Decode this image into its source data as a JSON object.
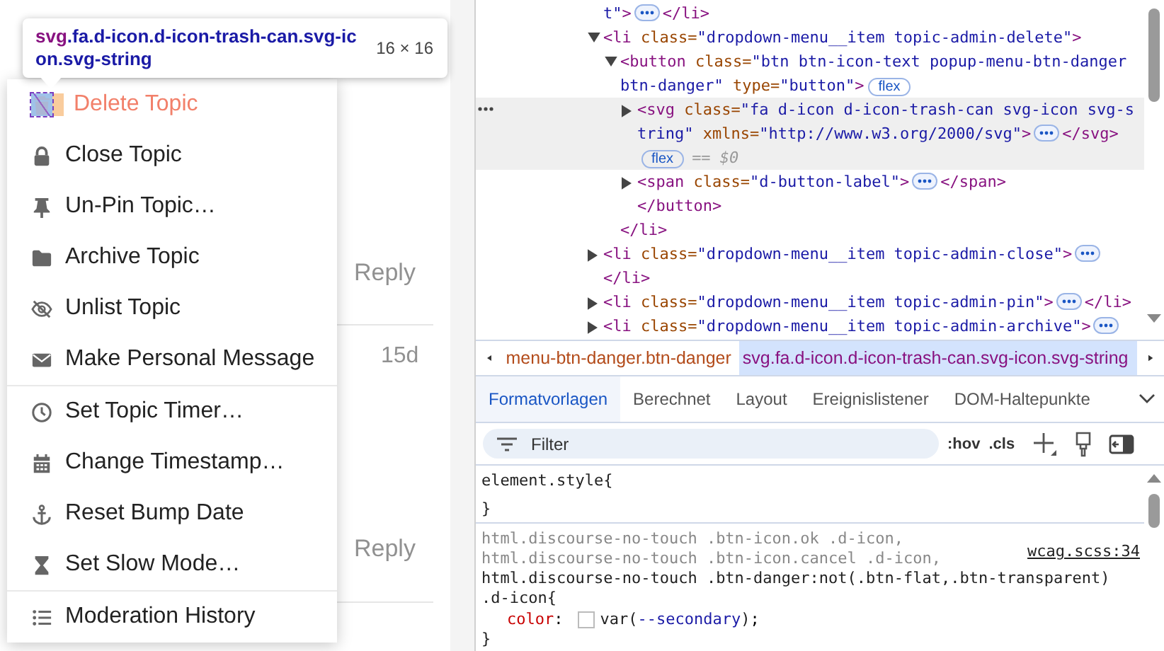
{
  "tooltip": {
    "tag": "svg",
    "classes": ".fa.d-icon.d-icon-trash-can.svg-icon.svg-string",
    "size": "16 × 16"
  },
  "page": {
    "replies": [
      {
        "label": "Reply"
      },
      {
        "label": "Reply"
      }
    ],
    "age": "15d"
  },
  "menu": {
    "sections": [
      [
        {
          "kind": "trash",
          "label": "Delete Topic",
          "danger": true,
          "highlighted": true
        },
        {
          "kind": "lock",
          "label": "Close Topic",
          "danger": false,
          "highlighted": false
        },
        {
          "kind": "pin",
          "label": "Un-Pin Topic…",
          "danger": false,
          "highlighted": false
        },
        {
          "kind": "folder",
          "label": "Archive Topic",
          "danger": false,
          "highlighted": false
        },
        {
          "kind": "unlist",
          "label": "Unlist Topic",
          "danger": false,
          "highlighted": false
        },
        {
          "kind": "message",
          "label": "Make Personal Message",
          "danger": false,
          "highlighted": false
        }
      ],
      [
        {
          "kind": "timer",
          "label": "Set Topic Timer…",
          "danger": false,
          "highlighted": false
        },
        {
          "kind": "timestamp",
          "label": "Change Timestamp…",
          "danger": false,
          "highlighted": false
        },
        {
          "kind": "bump",
          "label": "Reset Bump Date",
          "danger": false,
          "highlighted": false
        },
        {
          "kind": "slow",
          "label": "Set Slow Mode…",
          "danger": false,
          "highlighted": false
        }
      ],
      [
        {
          "kind": "history",
          "label": "Moderation History",
          "danger": false,
          "highlighted": false
        }
      ]
    ]
  },
  "elements": {
    "rows": [
      {
        "selected": false,
        "lines": [
          [
            {
              "kind": "value",
              "text": "t\""
            },
            {
              "kind": "tag",
              "text": ">"
            },
            {
              "kind": "more"
            },
            {
              "kind": "tag",
              "text": "</li>"
            }
          ]
        ]
      },
      {
        "expanded": true,
        "selected": false,
        "lines": [
          [
            {
              "kind": "tag",
              "text": "<li"
            },
            {
              "kind": "attr",
              "text": " class="
            },
            {
              "kind": "value",
              "text": "\"dropdown-menu__item topic-admin-delete\""
            },
            {
              "kind": "tag",
              "text": ">"
            }
          ]
        ],
        "children": [
          {
            "expanded": true,
            "selected": false,
            "lines": [
              [
                {
                  "kind": "tag",
                  "text": "<button"
                },
                {
                  "kind": "attr",
                  "text": " class="
                },
                {
                  "kind": "value",
                  "text": "\"btn btn-icon-text popup-menu-btn-danger"
                }
              ],
              [
                {
                  "kind": "value",
                  "text": "btn-danger\""
                },
                {
                  "kind": "attr",
                  "text": " type="
                },
                {
                  "kind": "value",
                  "text": "\"button\""
                },
                {
                  "kind": "tag",
                  "text": ">"
                },
                {
                  "kind": "badge",
                  "text": "flex"
                }
              ]
            ],
            "children": [
              {
                "expanded": false,
                "selected": true,
                "lines": [
                  [
                    {
                      "kind": "tag",
                      "text": "<svg"
                    },
                    {
                      "kind": "attr",
                      "text": " class="
                    },
                    {
                      "kind": "value",
                      "text": "\"fa d-icon d-icon-trash-can svg-icon svg-s"
                    }
                  ],
                  [
                    {
                      "kind": "value",
                      "text": "tring\""
                    },
                    {
                      "kind": "attr",
                      "text": " xmlns="
                    },
                    {
                      "kind": "value",
                      "text": "\"http://www.w3.org/2000/svg\""
                    },
                    {
                      "kind": "tag",
                      "text": ">"
                    },
                    {
                      "kind": "more"
                    },
                    {
                      "kind": "tag",
                      "text": "</svg>"
                    }
                  ],
                  [
                    {
                      "kind": "badge",
                      "text": "flex"
                    },
                    {
                      "kind": "ref",
                      "text": "== $0"
                    }
                  ]
                ]
              },
              {
                "expanded": false,
                "selected": false,
                "lines": [
                  [
                    {
                      "kind": "tag",
                      "text": "<span"
                    },
                    {
                      "kind": "attr",
                      "text": " class="
                    },
                    {
                      "kind": "value",
                      "text": "\"d-button-label\""
                    },
                    {
                      "kind": "tag",
                      "text": ">"
                    },
                    {
                      "kind": "more"
                    },
                    {
                      "kind": "tag",
                      "text": "</span>"
                    }
                  ]
                ]
              },
              {
                "selected": false,
                "lines": [
                  [
                    {
                      "kind": "tag",
                      "text": "</button>"
                    }
                  ]
                ]
              }
            ]
          },
          {
            "selected": false,
            "lines": [
              [
                {
                  "kind": "tag",
                  "text": "</li>"
                }
              ]
            ]
          }
        ]
      },
      {
        "expanded": false,
        "selected": false,
        "lines": [
          [
            {
              "kind": "tag",
              "text": "<li"
            },
            {
              "kind": "attr",
              "text": " class="
            },
            {
              "kind": "value",
              "text": "\"dropdown-menu__item topic-admin-close\""
            },
            {
              "kind": "tag",
              "text": ">"
            },
            {
              "kind": "more"
            }
          ]
        ]
      },
      {
        "selected": false,
        "lines": [
          [
            {
              "kind": "tag",
              "text": "</li>"
            }
          ]
        ]
      },
      {
        "expanded": false,
        "selected": false,
        "lines": [
          [
            {
              "kind": "tag",
              "text": "<li"
            },
            {
              "kind": "attr",
              "text": " class="
            },
            {
              "kind": "value",
              "text": "\"dropdown-menu__item topic-admin-pin\""
            },
            {
              "kind": "tag",
              "text": ">"
            },
            {
              "kind": "more"
            },
            {
              "kind": "tag",
              "text": "</li>"
            }
          ]
        ]
      },
      {
        "expanded": false,
        "selected": false,
        "lines": [
          [
            {
              "kind": "tag",
              "text": "<li"
            },
            {
              "kind": "attr",
              "text": " class="
            },
            {
              "kind": "value",
              "text": "\"dropdown-menu__item topic-admin-archive\""
            },
            {
              "kind": "tag",
              "text": ">"
            },
            {
              "kind": "more"
            }
          ]
        ]
      }
    ]
  },
  "breadcrumbs": [
    {
      "text": "menu-btn-danger.btn-danger",
      "selected": false
    },
    {
      "text": "svg.fa.d-icon.d-icon-trash-can.svg-icon.svg-string",
      "selected": true
    }
  ],
  "tabs": [
    {
      "label": "Formatvorlagen",
      "selected": true
    },
    {
      "label": "Berechnet",
      "selected": false
    },
    {
      "label": "Layout",
      "selected": false
    },
    {
      "label": "Ereignislistener",
      "selected": false
    },
    {
      "label": "DOM-Haltepunkte",
      "selected": false
    }
  ],
  "filter": {
    "placeholder": "Filter",
    "hov": ":hov",
    "cls": ".cls"
  },
  "rules": [
    {
      "selectors": [
        {
          "text": "element.style",
          "matched": true
        }
      ],
      "open": "{",
      "close": "}"
    },
    {
      "source": "wcag.scss:34",
      "selectors": [
        {
          "text": "html.discourse-no-touch .btn-icon.ok .d-icon,",
          "matched": false
        },
        {
          "text": "html.discourse-no-touch .btn-icon.cancel .d-icon,",
          "matched": false
        },
        {
          "text": "html.discourse-no-touch .btn-danger:not(.btn-flat,.btn-transparent)",
          "matched": true
        },
        {
          "text": ".d-icon",
          "matched": true
        }
      ],
      "open": "{",
      "close": "}",
      "declarations": [
        {
          "property": "color",
          "colon": ":",
          "swatch": true,
          "value": [
            {
              "kind": "fn",
              "text": "var("
            },
            {
              "kind": "var",
              "text": "--secondary"
            },
            {
              "kind": "fn",
              "text": ")"
            }
          ],
          "semicolon": ";"
        }
      ]
    }
  ]
}
